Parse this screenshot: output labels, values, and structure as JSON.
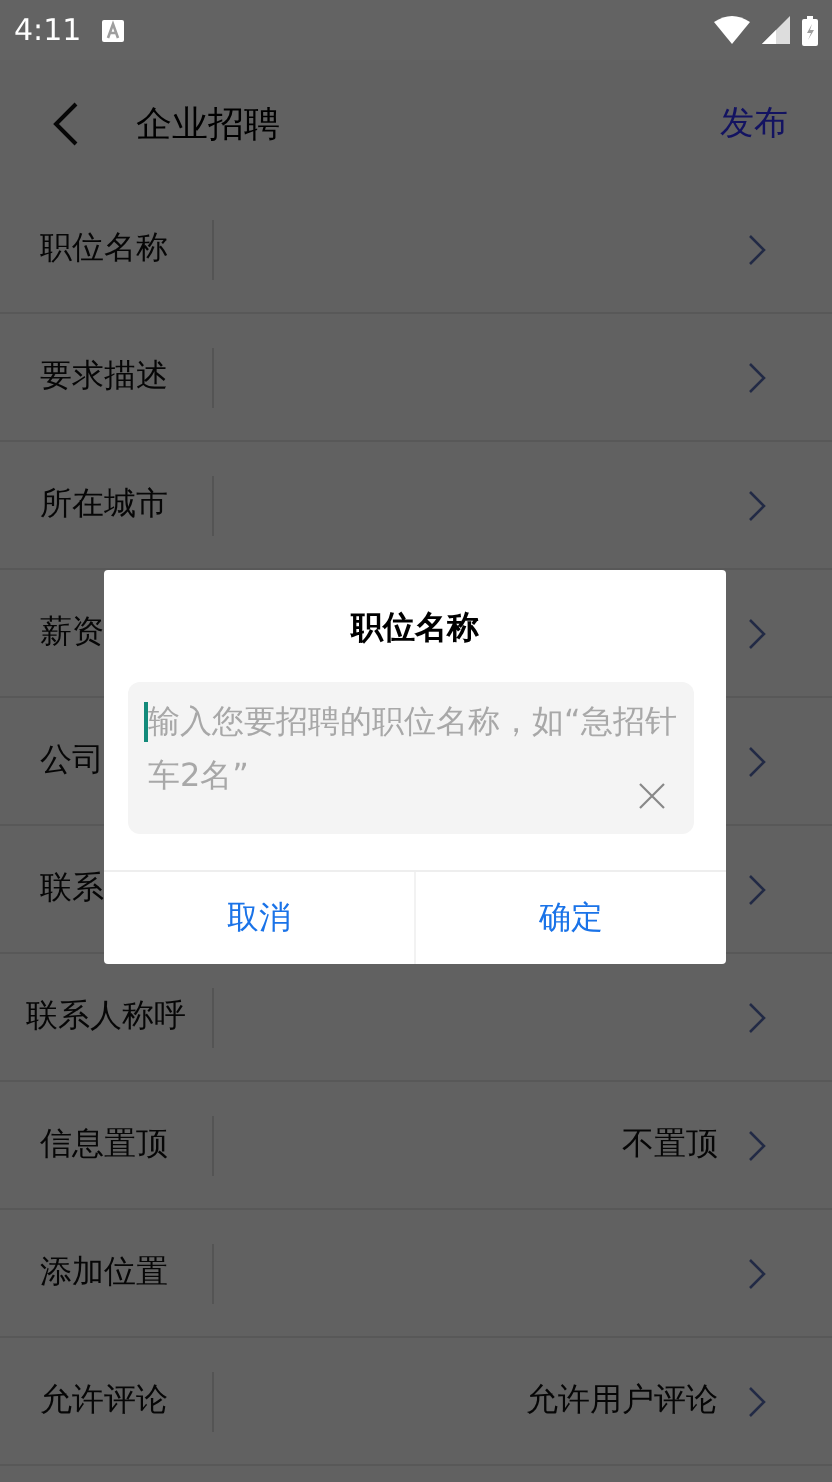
{
  "status_bar": {
    "time": "4:11"
  },
  "header": {
    "title": "企业招聘",
    "action": "发布"
  },
  "rows": [
    {
      "label": "职位名称"
    },
    {
      "label": "要求描述"
    },
    {
      "label": "所在城市"
    },
    {
      "label": "薪资"
    },
    {
      "label": "公司"
    },
    {
      "label": "联系"
    },
    {
      "label": "联系人称呼"
    },
    {
      "label": "信息置顶",
      "value": "不置顶"
    },
    {
      "label": "添加位置"
    },
    {
      "label": "允许评论",
      "value": "允许用户评论"
    }
  ],
  "dialog": {
    "title": "职位名称",
    "placeholder": "输入您要招聘的职位名称，如“急招针车2名”",
    "buttons": [
      "取消",
      "确定"
    ]
  }
}
